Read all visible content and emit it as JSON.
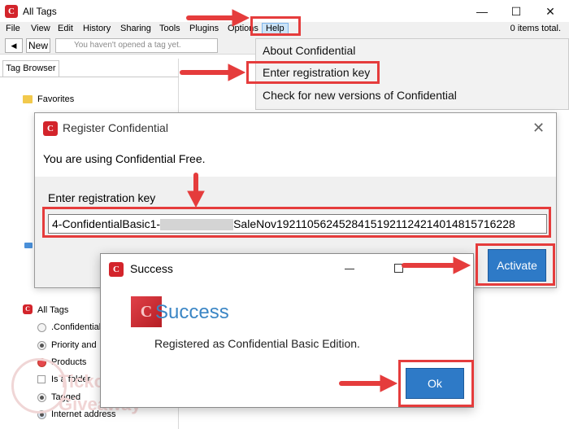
{
  "window": {
    "title": "All Tags",
    "minimize_glyph": "—",
    "maximize_glyph": "☐",
    "close_glyph": "✕"
  },
  "menubar": {
    "items": [
      "File",
      "View",
      "Edit",
      "History",
      "Sharing",
      "Tools",
      "Plugins",
      "Options",
      "Help"
    ],
    "items_total": "0 items total."
  },
  "toolbar": {
    "back_glyph": "◀",
    "new_label": "New",
    "tag_placeholder": "You haven't opened a tag yet."
  },
  "left_panel": {
    "tab_label": "Tag Browser",
    "favorites_label": "Favorites",
    "all_tags_label": "All Tags",
    "tree_items": [
      ".Confidential",
      "Priority and …",
      "Products",
      "Is a folder",
      "Tagged",
      "Internet address"
    ]
  },
  "help_menu": {
    "items": [
      "About Confidential",
      "Enter registration key",
      "Check for new versions of Confidential"
    ]
  },
  "register_dialog": {
    "title": "Register Confidential",
    "status_text": "You are using Confidential Free.",
    "key_label": "Enter registration key",
    "key_prefix": "4-ConfidentialBasic1-",
    "key_suffix": "SaleNov19211056245284151921124214014815716228",
    "activate_label": "Activate"
  },
  "success_dialog": {
    "title": "Success",
    "heading": "Success",
    "message": "Registered as Confidential Basic Edition.",
    "ok_label": "Ok"
  },
  "watermark": {
    "line1": "Tickcoupon",
    "line2": "Giveaway"
  },
  "colors": {
    "accent_blue": "#2e7ac7",
    "brand_red": "#d3242b",
    "annotation_red": "#e53c3c"
  }
}
